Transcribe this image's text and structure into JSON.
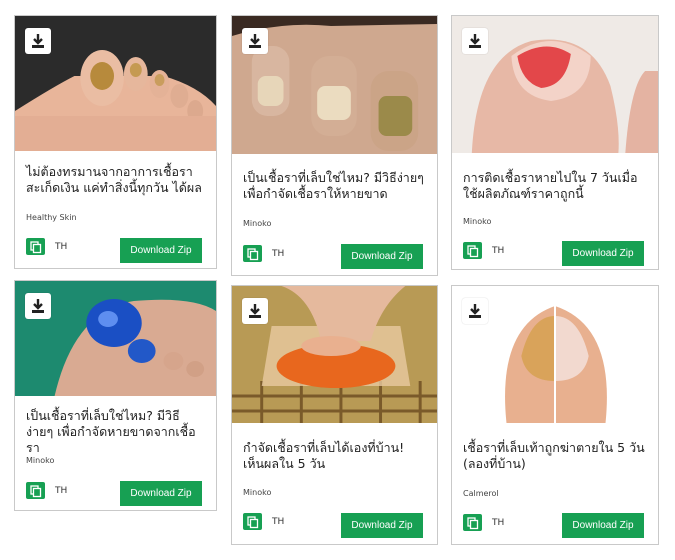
{
  "cards": [
    {
      "title": "ไม่ต้องทรมานจากอาการเชื้อรา สะเก็ดเงิน แค่ทำสิ่งนี้ทุกวัน ได้ผล",
      "source": "Healthy Skin",
      "lang": "TH",
      "button": "Download Zip",
      "icon": "download-icon"
    },
    {
      "title": "เป็นเชื้อราที่เล็บใช่ไหม? มีวิธีง่ายๆ เพื่อกำจัดเชื้อราให้หายขาด",
      "source": "Minoko",
      "lang": "TH",
      "button": "Download Zip",
      "icon": "download-icon"
    },
    {
      "title": "การติดเชื้อราหายไปใน 7 วันเมื่อ ใช้ผลิตภัณฑ์ราคาถูกนี้",
      "source": "Minoko",
      "lang": "TH",
      "button": "Download Zip",
      "icon": "download-icon"
    },
    {
      "title": "เป็นเชื้อราที่เล็บใช่ไหม? มีวิธีง่ายๆ เพื่อกำจัดหายขาดจากเชื้อรา",
      "source": "Minoko",
      "lang": "TH",
      "button": "Download Zip",
      "icon": "download-icon"
    },
    {
      "title": "กำจัดเชื้อราที่เล็บได้เองที่บ้าน! เห็นผลใน 5 วัน",
      "source": "Minoko",
      "lang": "TH",
      "button": "Download Zip",
      "icon": "download-icon"
    },
    {
      "title": "เชื้อราที่เล็บเท้าถูกฆ่าตายใน 5 วัน (ลองที่บ้าน)",
      "source": "Calmerol",
      "lang": "TH",
      "button": "Download Zip",
      "icon": "download-icon"
    }
  ],
  "colors": {
    "accent": "#17a053",
    "border": "#c9c9c9"
  }
}
